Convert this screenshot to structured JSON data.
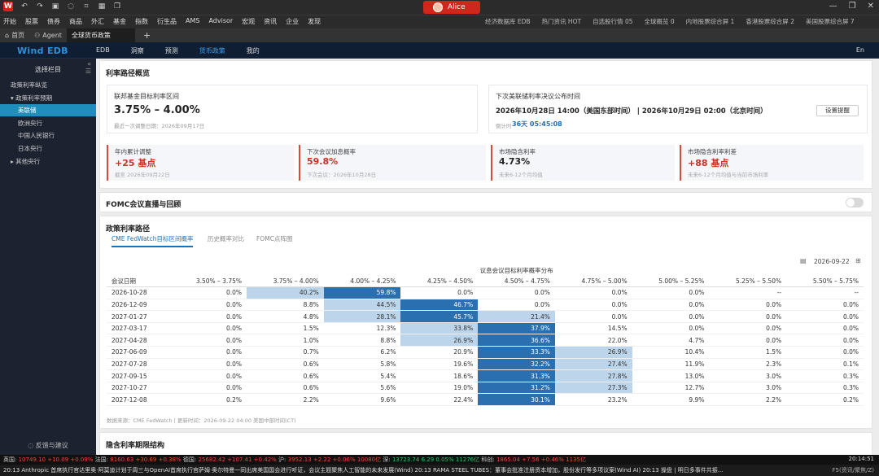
{
  "titlebar": {
    "user": "Alice",
    "icons": [
      "undo-icon",
      "redo-icon",
      "pdf-icon",
      "chat-icon",
      "screenshot-icon",
      "grid-icon",
      "copy-icon"
    ]
  },
  "menu": {
    "left": [
      "开始",
      "股票",
      "债券",
      "商品",
      "外汇",
      "基金",
      "指数",
      "衍生品",
      "AMS",
      "Advisor",
      "宏观",
      "资讯",
      "企业",
      "发现"
    ],
    "right": [
      "经济数据库 EDB",
      "热门资讯 HOT",
      "自选股行情 05",
      "全球概览 0",
      "内地股票综合屏 1",
      "香港股票综合屏 2",
      "美国股票综合屏 7"
    ]
  },
  "tabs": [
    {
      "label": "首页"
    },
    {
      "label": "Agent"
    },
    {
      "label": "全球货币政策"
    }
  ],
  "nav": {
    "brand": "Wind EDB",
    "items": [
      "EDB",
      "洞察",
      "预测",
      "货币政策",
      "我的"
    ],
    "active": 3,
    "lang": "En"
  },
  "sidebar": {
    "title": "选择栏目",
    "items": [
      {
        "label": "政策利率纵览",
        "indent": 0
      },
      {
        "label": "▾ 政策利率预期",
        "indent": 0
      },
      {
        "label": "美联储",
        "indent": 1,
        "active": true
      },
      {
        "label": "欧洲央行",
        "indent": 1
      },
      {
        "label": "中国人民银行",
        "indent": 1
      },
      {
        "label": "日本央行",
        "indent": 1
      },
      {
        "label": "▸ 其他央行",
        "indent": 0
      }
    ],
    "feedback": "反馈与建议"
  },
  "overview": {
    "title": "利率路径概览",
    "target": {
      "label": "联邦基金目标利率区间",
      "value": "3.75% – 4.00%",
      "sub": "最近一次调整日期：2026年09月17日"
    },
    "next": {
      "label": "下次美联储利率决议公布时间",
      "value": "2026年10月28日 14:00（美国东部时间） | 2026年10月29日 02:00（北京时间）",
      "countdown_label": "倒计时",
      "countdown": "36天 05:45:08",
      "button": "设置提醒"
    },
    "stats": [
      {
        "label": "年内累计调整",
        "value": "+25 基点",
        "sub": "截至 2026年09月22日",
        "red": true
      },
      {
        "label": "下次会议加息概率",
        "value": "59.8%",
        "sub": "下次会议：2026年10月28日",
        "red": true
      },
      {
        "label": "市场隐含利率",
        "value": "4.73%",
        "sub": "未来6-12个月均值",
        "red": false
      },
      {
        "label": "市场隐含利率利差",
        "value": "+88 基点",
        "sub": "未来6-12个月均值与当前市场利率",
        "red": true
      }
    ]
  },
  "fomc": {
    "title": "FOMC会议直播与回顾"
  },
  "path": {
    "title": "政策利率路径",
    "tabs": [
      "CME FedWatch目标区间概率",
      "历史概率对比",
      "FOMC点阵图"
    ],
    "date": "2026-09-22",
    "group_header": "议息会议目标利率概率分布",
    "date_col": "会议日期",
    "columns": [
      "3.50% – 3.75%",
      "3.75% – 4.00%",
      "4.00% – 4.25%",
      "4.25% – 4.50%",
      "4.50% – 4.75%",
      "4.75% – 5.00%",
      "5.00% – 5.25%",
      "5.25% – 5.50%",
      "5.50% – 5.75%"
    ],
    "rows": [
      {
        "date": "2026-10-28",
        "values": [
          "0.0%",
          "40.2%",
          "59.8%",
          "0.0%",
          "0.0%",
          "0.0%",
          "0.0%",
          "--",
          "--"
        ]
      },
      {
        "date": "2026-12-09",
        "values": [
          "0.0%",
          "8.8%",
          "44.5%",
          "46.7%",
          "0.0%",
          "0.0%",
          "0.0%",
          "0.0%",
          "0.0%"
        ]
      },
      {
        "date": "2027-01-27",
        "values": [
          "0.0%",
          "4.8%",
          "28.1%",
          "45.7%",
          "21.4%",
          "0.0%",
          "0.0%",
          "0.0%",
          "0.0%"
        ]
      },
      {
        "date": "2027-03-17",
        "values": [
          "0.0%",
          "1.5%",
          "12.3%",
          "33.8%",
          "37.9%",
          "14.5%",
          "0.0%",
          "0.0%",
          "0.0%"
        ]
      },
      {
        "date": "2027-04-28",
        "values": [
          "0.0%",
          "1.0%",
          "8.8%",
          "26.9%",
          "36.6%",
          "22.0%",
          "4.7%",
          "0.0%",
          "0.0%"
        ]
      },
      {
        "date": "2027-06-09",
        "values": [
          "0.0%",
          "0.7%",
          "6.2%",
          "20.9%",
          "33.3%",
          "26.9%",
          "10.4%",
          "1.5%",
          "0.0%"
        ]
      },
      {
        "date": "2027-07-28",
        "values": [
          "0.0%",
          "0.6%",
          "5.8%",
          "19.6%",
          "32.2%",
          "27.4%",
          "11.9%",
          "2.3%",
          "0.1%"
        ]
      },
      {
        "date": "2027-09-15",
        "values": [
          "0.0%",
          "0.6%",
          "5.4%",
          "18.6%",
          "31.3%",
          "27.8%",
          "13.0%",
          "3.0%",
          "0.3%"
        ]
      },
      {
        "date": "2027-10-27",
        "values": [
          "0.0%",
          "0.6%",
          "5.6%",
          "19.0%",
          "31.2%",
          "27.3%",
          "12.7%",
          "3.0%",
          "0.3%"
        ]
      },
      {
        "date": "2027-12-08",
        "values": [
          "0.2%",
          "2.2%",
          "9.6%",
          "22.4%",
          "30.1%",
          "23.2%",
          "9.9%",
          "2.2%",
          "0.2%"
        ]
      }
    ],
    "source": "数据来源：CME FedWatch | 更新时间：2026-09-22 04:00 美国中部时间(CT)"
  },
  "implied": {
    "title": "隐含利率期限结构"
  },
  "ticker1": [
    {
      "t": "英国: ",
      "c": ""
    },
    {
      "t": "10749.10",
      "c": "up"
    },
    {
      "t": "  +10.09  ",
      "c": "up"
    },
    {
      "t": "+0.09%  ",
      "c": "up"
    },
    {
      "t": "法国: ",
      "c": ""
    },
    {
      "t": "8160.63",
      "c": "up"
    },
    {
      "t": "  +30.69  ",
      "c": "up"
    },
    {
      "t": "+0.38%  ",
      "c": "up"
    },
    {
      "t": "德国: ",
      "c": ""
    },
    {
      "t": "25682.42",
      "c": "up"
    },
    {
      "t": "  +107.41  ",
      "c": "up"
    },
    {
      "t": "+0.42%  ",
      "c": "up"
    },
    {
      "t": "沪: ",
      "c": ""
    },
    {
      "t": "3952.13",
      "c": "up"
    },
    {
      "t": "  +2.22  ",
      "c": "up"
    },
    {
      "t": "+0.06%  ",
      "c": "up"
    },
    {
      "t": "10080亿  ",
      "c": "up"
    },
    {
      "t": "深: ",
      "c": ""
    },
    {
      "t": "13723.74",
      "c": "dn"
    },
    {
      "t": "  6.29  ",
      "c": "dn"
    },
    {
      "t": "0.05%  ",
      "c": "dn"
    },
    {
      "t": "11276亿  ",
      "c": "dn"
    },
    {
      "t": "科创: ",
      "c": ""
    },
    {
      "t": "1865.04",
      "c": "up"
    },
    {
      "t": "  +7.56  ",
      "c": "up"
    },
    {
      "t": "+0.46%  ",
      "c": "up"
    },
    {
      "t": "1135亿",
      "c": "up"
    }
  ],
  "ticker1_time": "20:14:51",
  "ticker2": "20:13  Anthropic 首席执行官达里奥·阿莫迪计划于周三与OpenAI首席执行官萨姆·奥尔特曼一同出席美国国会进行听证，会议主题聚焦人工智能的未来发展(Wind)     20:13  RAMA STEEL TUBES：董事会批准注册资本增加，股份发行等多项议案(Wind AI)     20:13  操盘 | 明日多事件共振...",
  "ticker2_right": "F5(资讯/聚焦/Z)",
  "colors": {
    "heat_max": "#2a6fb0",
    "heat_mid": "#6ea3cf",
    "heat_low": "#bcd5ea",
    "accent": "#1f6fb5",
    "red": "#c83226",
    "brand": "#2f8fd9"
  }
}
